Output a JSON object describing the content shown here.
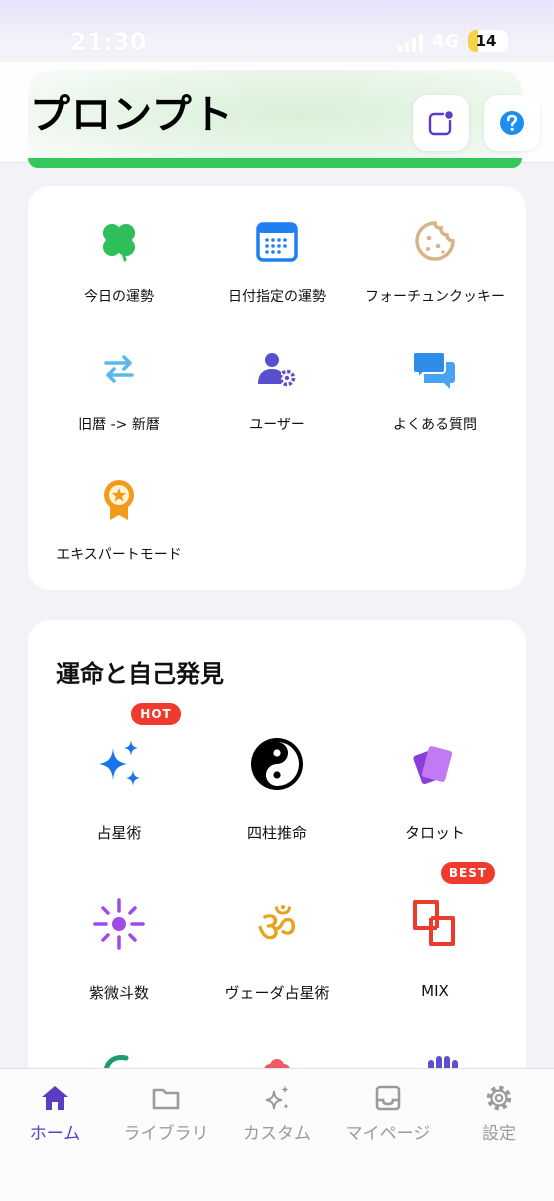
{
  "status_bar": {
    "time": "21:30",
    "network": "4G",
    "battery": "14"
  },
  "header": {
    "title": "プロンプト"
  },
  "tools": [
    {
      "label": "今日の運勢",
      "icon": "clover-icon"
    },
    {
      "label": "日付指定の運勢",
      "icon": "calendar-icon"
    },
    {
      "label": "フォーチュンクッキー",
      "icon": "cookie-icon"
    },
    {
      "label": "旧暦 -> 新暦",
      "icon": "swap-arrows-icon"
    },
    {
      "label": "ユーザー",
      "icon": "user-settings-icon"
    },
    {
      "label": "よくある質問",
      "icon": "chat-bubbles-icon"
    },
    {
      "label": "エキスパートモード",
      "icon": "medal-icon"
    }
  ],
  "section": {
    "title": "運命と自己発見",
    "items": [
      {
        "label": "占星術",
        "icon": "sparkles-icon",
        "badge": "HOT"
      },
      {
        "label": "四柱推命",
        "icon": "yin-yang-icon"
      },
      {
        "label": "タロット",
        "icon": "cards-icon"
      },
      {
        "label": "紫微斗数",
        "icon": "star-burst-icon"
      },
      {
        "label": "ヴェーダ占星術",
        "icon": "om-icon"
      },
      {
        "label": "MIX",
        "icon": "overlap-squares-icon",
        "badge": "BEST"
      }
    ]
  },
  "tabbar": {
    "tabs": [
      {
        "label": "ホーム",
        "icon": "home-icon",
        "active": true
      },
      {
        "label": "ライブラリ",
        "icon": "folder-icon"
      },
      {
        "label": "カスタム",
        "icon": "sparkle-icon"
      },
      {
        "label": "マイページ",
        "icon": "inbox-icon"
      },
      {
        "label": "設定",
        "icon": "gear-icon"
      }
    ]
  },
  "colors": {
    "accent": "#5b3cc4",
    "header_strip": "#34c759",
    "badge": "#f03a2e"
  }
}
